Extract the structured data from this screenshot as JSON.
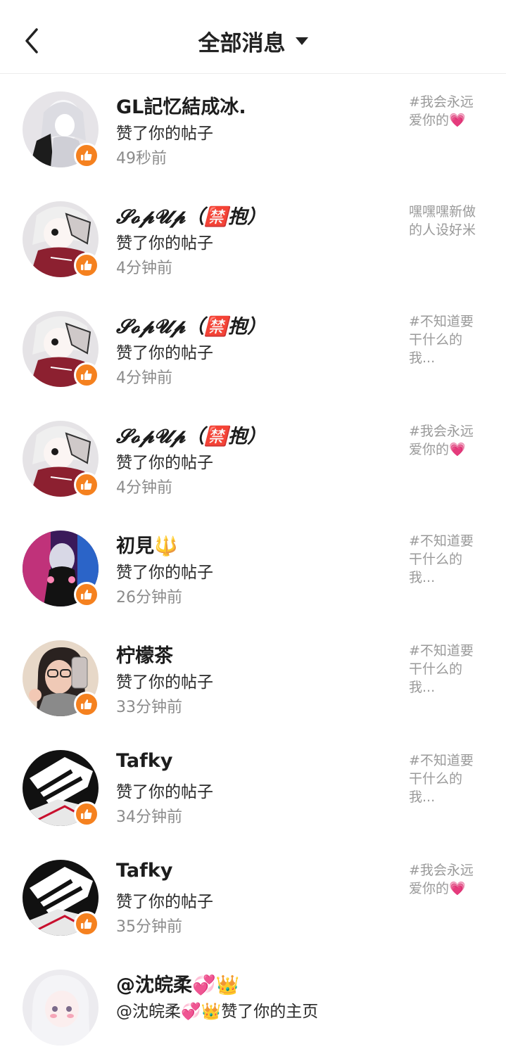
{
  "header": {
    "title": "全部消息",
    "back_icon": "chevron-left-icon",
    "dropdown_icon": "caret-down-icon"
  },
  "colors": {
    "like_badge": "#f5811f",
    "meta_text": "#8b8b8b",
    "snippet_text": "#9a9a9a"
  },
  "notifications": [
    {
      "name": "GL記忆結成冰.",
      "action": "赞了你的帖子",
      "time": "49秒前",
      "snippet": "#我会永远\n爱你的💗"
    },
    {
      "name": "𝓢𝓸𝓹𝓤𝓹（🈲抱）",
      "action": "赞了你的帖子",
      "time": "4分钟前",
      "snippet": "嘿嘿嘿新做\n的人设好米"
    },
    {
      "name": "𝓢𝓸𝓹𝓤𝓹（🈲抱）",
      "action": "赞了你的帖子",
      "time": "4分钟前",
      "snippet": "#不知道要\n干什么的\n我..."
    },
    {
      "name": "𝓢𝓸𝓹𝓤𝓹（🈲抱）",
      "action": "赞了你的帖子",
      "time": "4分钟前",
      "snippet": "#我会永远\n爱你的💗"
    },
    {
      "name": "初見🔱",
      "action": "赞了你的帖子",
      "time": "26分钟前",
      "snippet": "#不知道要\n干什么的\n我..."
    },
    {
      "name": "柠檬茶",
      "action": "赞了你的帖子",
      "time": "33分钟前",
      "snippet": "#不知道要\n干什么的\n我..."
    },
    {
      "name": "Tafky",
      "action": "赞了你的帖子",
      "time": "34分钟前",
      "snippet": "#不知道要\n干什么的\n我..."
    },
    {
      "name": "Tafky",
      "action": "赞了你的帖子",
      "time": "35分钟前",
      "snippet": "#我会永远\n爱你的💗"
    },
    {
      "name": "@沈皖柔💞👑",
      "action": "@沈皖柔💞👑赞了你的主页",
      "time": "",
      "snippet": ""
    }
  ]
}
